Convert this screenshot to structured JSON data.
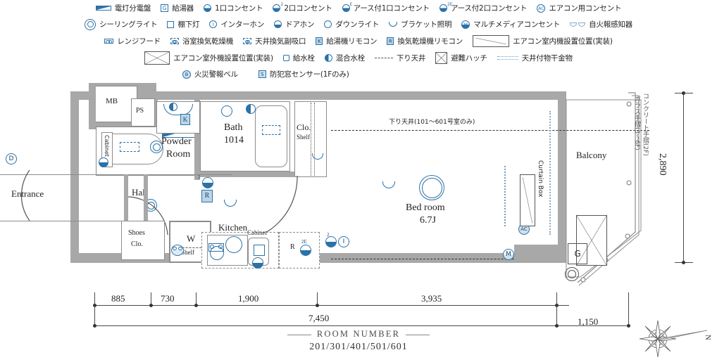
{
  "legend": {
    "rows": [
      [
        {
          "icon": "distribution-board-icon",
          "label": "電灯分電盤"
        },
        {
          "icon": "water-heater-icon",
          "label": "給湯器",
          "glyph": "G"
        },
        {
          "icon": "outlet-1-icon",
          "label": "1口コンセント"
        },
        {
          "icon": "outlet-2-icon",
          "label": "2口コンセント",
          "sup": "2"
        },
        {
          "icon": "grounded-outlet-1-icon",
          "label": "アース付1口コンセント",
          "sup": "E"
        },
        {
          "icon": "grounded-outlet-2-icon",
          "label": "アース付2口コンセント",
          "sup": "2E"
        },
        {
          "icon": "aircon-outlet-icon",
          "label": "エアコン用コンセント",
          "glyph": "AC"
        }
      ],
      [
        {
          "icon": "ceiling-light-icon",
          "label": "シーリングライト"
        },
        {
          "icon": "under-shelf-light-icon",
          "label": "棚下灯"
        },
        {
          "icon": "interphone-icon",
          "label": "インターホン",
          "glyph": "I"
        },
        {
          "icon": "door-phone-icon",
          "label": "ドアホン"
        },
        {
          "icon": "downlight-icon",
          "label": "ダウンライト"
        },
        {
          "icon": "bracket-light-icon",
          "label": "ブラケット照明"
        },
        {
          "icon": "multimedia-outlet-icon",
          "label": "マルチメディアコンセント",
          "glyph": "M"
        },
        {
          "icon": "fire-detector-icon",
          "label": "自火報感知器"
        }
      ],
      [
        {
          "icon": "range-hood-icon",
          "label": "レンジフード"
        },
        {
          "icon": "bath-dryer-icon",
          "label": "浴室換気乾燥機"
        },
        {
          "icon": "ceiling-vent-icon",
          "label": "天井換気副吸口"
        },
        {
          "icon": "water-heater-remote-icon",
          "label": "給湯機リモコン",
          "glyph": "K"
        },
        {
          "icon": "dryer-remote-icon",
          "label": "換気乾燥機リモコン",
          "glyph": "R"
        },
        {
          "icon": "aircon-indoor-position-icon",
          "label": "エアコン室内機設置位置(実装)"
        }
      ],
      [
        {
          "icon": "aircon-outdoor-position-icon",
          "label": "エアコン室外機設置位置(実装)"
        },
        {
          "icon": "water-tap-icon",
          "label": "給水栓"
        },
        {
          "icon": "mixing-tap-icon",
          "label": "混合水栓"
        },
        {
          "icon": "dropped-ceiling-icon",
          "label": "下り天井"
        },
        {
          "icon": "evacuation-hatch-icon",
          "label": "避難ハッチ"
        },
        {
          "icon": "ceiling-hanger-icon",
          "label": "天井付物干金物"
        }
      ],
      [
        {
          "icon": "fire-alarm-bell-icon",
          "label": "火災警報ベル",
          "glyph": "B"
        },
        {
          "icon": "security-window-sensor-icon",
          "label": "防犯窓センサー(1Fのみ)",
          "glyph": "S"
        }
      ]
    ]
  },
  "plan": {
    "rooms": {
      "mb": "MB",
      "ps": "PS",
      "powder_room": "Powder\nRoom",
      "powder_room_l1": "Powder",
      "powder_room_l2": "Room",
      "cabinet_powder": "Cabinet",
      "bath_l1": "Bath",
      "bath_l2": "1014",
      "closet_l1": "Clo.",
      "closet_l2": "Shelf",
      "entrance": "Entrance",
      "hall": "Hall",
      "shoes_clo_l1": "Shoes",
      "shoes_clo_l2": "Clo.",
      "washer": "W",
      "washer_shelf": "Shelf",
      "kitchen": "Kitchen",
      "kitchen_cabinet": "Cabinet",
      "bed_room_l1": "Bed room",
      "bed_room_l2": "6.7J",
      "balcony": "Balcony",
      "curtain_box": "Curtain Box"
    },
    "notes": {
      "dropped_ceiling": "下り天井(101〜601号室のみ)",
      "handrail_concrete": "コンクリート手摺(2F)",
      "handrail_glass": "ガラス手摺(3〜6F)"
    },
    "markers": {
      "d": "D",
      "k": "K",
      "r": "R",
      "r_kitchen": "R",
      "g": "G",
      "ac": "AC",
      "m": "M",
      "i": "I",
      "sup2": "2",
      "sup2e": "2E"
    }
  },
  "dimensions": {
    "bottom": [
      {
        "value": "885"
      },
      {
        "value": "730"
      },
      {
        "value": "1,900"
      },
      {
        "value": "3,935"
      },
      {
        "value": "1,150"
      }
    ],
    "total": "7,450",
    "vertical": "2,890"
  },
  "footer": {
    "room_number_title": "ROOM NUMBER",
    "room_numbers": "201/301/401/501/601"
  },
  "compass": {
    "north_label": "N"
  },
  "colors": {
    "accent": "#2b72a8",
    "wall": "#a8a8a8",
    "text": "#231f20"
  }
}
